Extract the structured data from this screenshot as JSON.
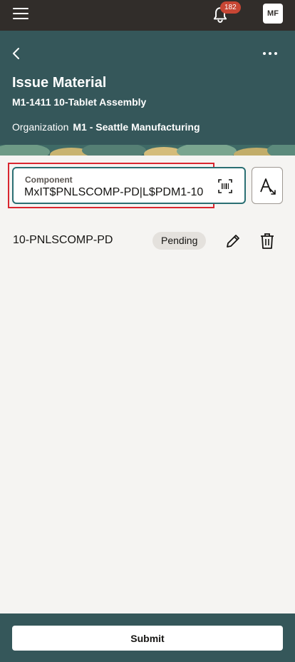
{
  "colors": {
    "topbar": "#312d2a",
    "hero": "#35575a",
    "accent": "#2a6f73",
    "badge": "#c74634",
    "highlight": "#d9262f"
  },
  "topbar": {
    "menu_icon": "hamburger-icon",
    "bell_icon": "bell-icon",
    "notification_count": "182",
    "avatar_initials": "MF"
  },
  "header": {
    "back_icon": "chevron-left-icon",
    "more_icon": "ellipsis-icon",
    "title": "Issue Material",
    "subtitle": "M1-1411 10-Tablet Assembly",
    "organization_label": "Organization",
    "organization_value": "M1 - Seattle Manufacturing"
  },
  "component_field": {
    "label": "Component",
    "value": "MxIT$PNLSCOMP-PD|L$PDM1-10",
    "scan_icon": "barcode-scan-icon"
  },
  "font_button": {
    "icon": "text-size-icon"
  },
  "items": [
    {
      "name": "10-PNLSCOMP-PD",
      "status": "Pending",
      "edit_icon": "pencil-icon",
      "delete_icon": "trash-icon"
    }
  ],
  "footer": {
    "submit_label": "Submit"
  }
}
